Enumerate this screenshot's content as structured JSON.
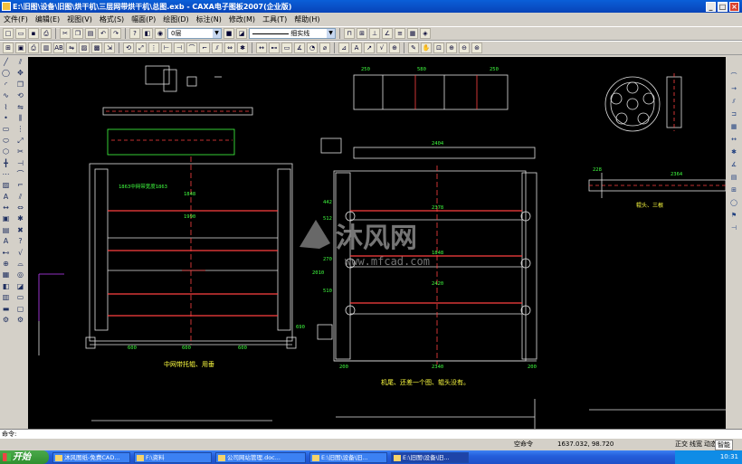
{
  "window": {
    "title": "E:\\旧图\\设备\\旧图\\烘干机\\三层网带烘干机\\总图.exb - CAXA电子图板2007(企业版)",
    "buttons": [
      "_",
      "□",
      "×"
    ]
  },
  "menu": {
    "items": [
      "文件(F)",
      "编辑(E)",
      "视图(V)",
      "格式(S)",
      "幅面(P)",
      "绘图(D)",
      "标注(N)",
      "修改(M)",
      "工具(T)",
      "帮助(H)"
    ]
  },
  "toolbar": {
    "layer_value": "0层",
    "linetype_value": "细实线"
  },
  "drawing": {
    "watermark_main": "沐风网",
    "watermark_url": "www.mfcad.com",
    "left_view": {
      "dims_top": [
        "1863中网带宽度1863",
        "1848",
        "1990"
      ],
      "dims_bottom": [
        "600",
        "600",
        "600"
      ],
      "dims_left": [
        "690"
      ],
      "caption": "中网带托辊、用垂"
    },
    "center_view": {
      "dims_top": [
        "250",
        "580",
        "250"
      ],
      "dim_2404": "2404",
      "dims_right": [
        "442",
        "512",
        "2010",
        "270",
        "510"
      ],
      "dims_inner": [
        "2378",
        "1848",
        "2420"
      ],
      "dims_bottom": [
        "200",
        "2340",
        "200"
      ],
      "caption": "机尾、还差一个图、辊头没有。"
    },
    "right_view": {
      "dim_228": "228",
      "dim_2364": "2364",
      "caption": "辊头、三根"
    }
  },
  "command": {
    "prompt": "命令:"
  },
  "status": {
    "mode": "空命令",
    "coords": "1637.032, 98.720",
    "snap_items": [
      "正交",
      "线宽",
      "动态输入"
    ],
    "snap_mode": "智能"
  },
  "taskbar": {
    "start_label": "开始",
    "tasks": [
      {
        "label": "沐风图纸-免费CAD..."
      },
      {
        "label": "F:\\资料"
      },
      {
        "label": "公司网站管理.doc..."
      },
      {
        "label": "E:\\旧图\\设备\\旧..."
      },
      {
        "label": "E:\\旧图\\设备\\旧..."
      }
    ],
    "clock": "10:31"
  }
}
